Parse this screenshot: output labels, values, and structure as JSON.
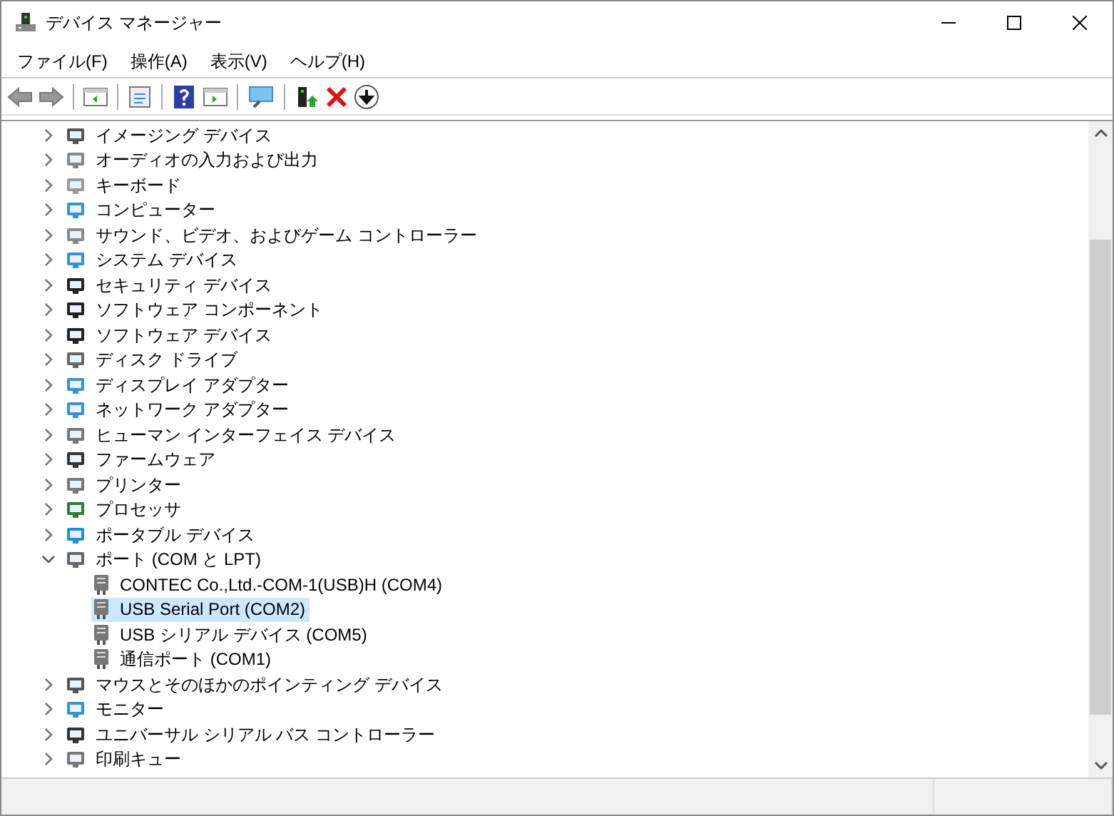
{
  "window": {
    "title": "デバイス マネージャー"
  },
  "menu": [
    "ファイル(F)",
    "操作(A)",
    "表示(V)",
    "ヘルプ(H)"
  ],
  "tree": [
    {
      "label": "イメージング デバイス",
      "expanded": false
    },
    {
      "label": "オーディオの入力および出力",
      "expanded": false
    },
    {
      "label": "キーボード",
      "expanded": false
    },
    {
      "label": "コンピューター",
      "expanded": false
    },
    {
      "label": "サウンド、ビデオ、およびゲーム コントローラー",
      "expanded": false
    },
    {
      "label": "システム デバイス",
      "expanded": false
    },
    {
      "label": "セキュリティ デバイス",
      "expanded": false
    },
    {
      "label": "ソフトウェア コンポーネント",
      "expanded": false
    },
    {
      "label": "ソフトウェア デバイス",
      "expanded": false
    },
    {
      "label": "ディスク ドライブ",
      "expanded": false
    },
    {
      "label": "ディスプレイ アダプター",
      "expanded": false
    },
    {
      "label": "ネットワーク アダプター",
      "expanded": false
    },
    {
      "label": "ヒューマン インターフェイス デバイス",
      "expanded": false
    },
    {
      "label": "ファームウェア",
      "expanded": false
    },
    {
      "label": "プリンター",
      "expanded": false
    },
    {
      "label": "プロセッサ",
      "expanded": false
    },
    {
      "label": "ポータブル デバイス",
      "expanded": false
    },
    {
      "label": "ポート (COM と LPT)",
      "expanded": true,
      "children": [
        {
          "label": "CONTEC Co.,Ltd.-COM-1(USB)H (COM4)",
          "selected": false
        },
        {
          "label": "USB Serial Port (COM2)",
          "selected": true
        },
        {
          "label": "USB シリアル デバイス (COM5)",
          "selected": false
        },
        {
          "label": "通信ポート (COM1)",
          "selected": false
        }
      ]
    },
    {
      "label": "マウスとそのほかのポインティング デバイス",
      "expanded": false
    },
    {
      "label": "モニター",
      "expanded": false
    },
    {
      "label": "ユニバーサル シリアル バス コントローラー",
      "expanded": false
    },
    {
      "label": "印刷キュー",
      "expanded": false
    }
  ]
}
